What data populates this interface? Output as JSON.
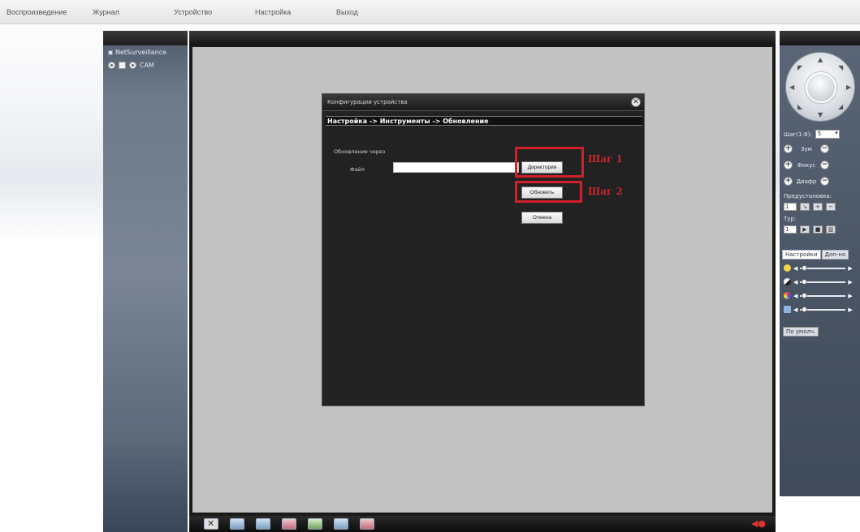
{
  "menu": {
    "items": [
      "Воспроизведение",
      "Журнал",
      "Устройство",
      "Настройка",
      "Выход"
    ]
  },
  "device_tree": {
    "root_label": "NetSurveillance",
    "channel_label": "CAM"
  },
  "dialog": {
    "title": "Конфигурации устройства",
    "breadcrumb": "Настройка -> Инструменты -> Обновление",
    "upgrade_via_label": "Обновление через",
    "file_label": "Файл",
    "file_value": "",
    "directory_button": "Директория",
    "upgrade_button": "Обновить",
    "cancel_button": "Отмена"
  },
  "annotations": {
    "step1": "Шаг 1",
    "step2": "Шаг 2",
    "highlight_color": "#d21f2b"
  },
  "ptz": {
    "speed_label": "Шаг(1-8):",
    "speed_value": "5",
    "zoom_label": "Зум",
    "focus_label": "Фокус",
    "iris_label": "Диафр",
    "preset_label": "Предустановка:",
    "preset_value": "1",
    "tour_label": "Тур:",
    "tour_value": "1",
    "tabs": [
      "Настройки",
      "Доп-но"
    ],
    "default_button": "По умолч."
  }
}
